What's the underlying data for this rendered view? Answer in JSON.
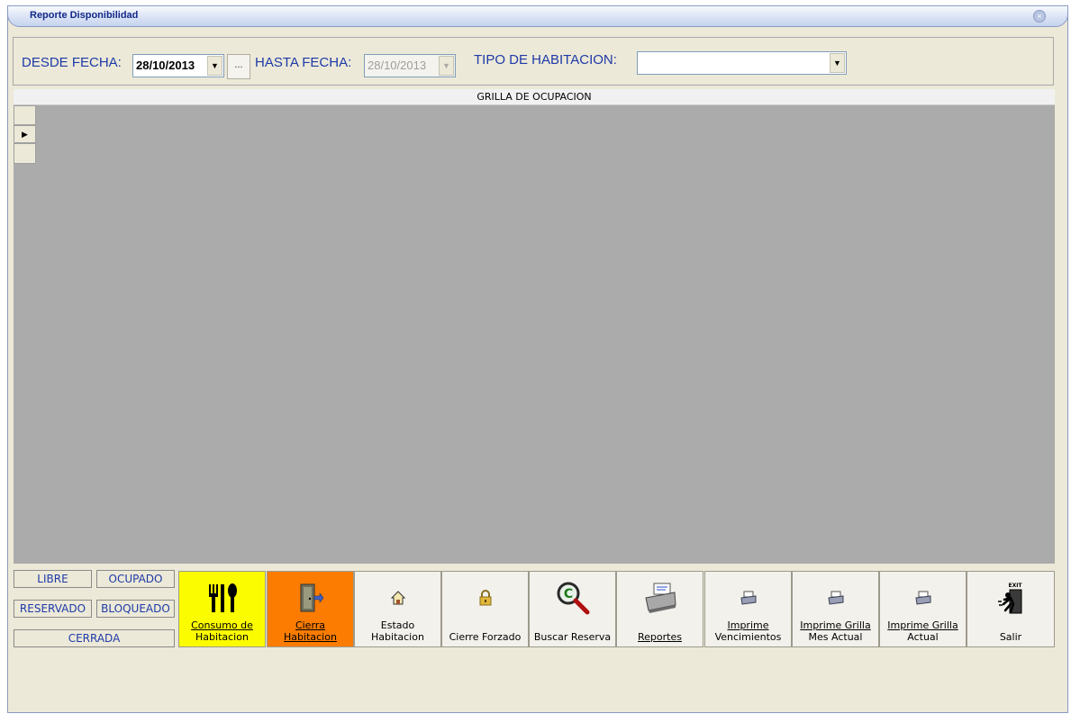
{
  "window": {
    "title": "Reporte Disponibilidad"
  },
  "filters": {
    "desde_label": "DESDE FECHA:",
    "desde_value": "28/10/2013",
    "dots_label": "...",
    "hasta_label": "HASTA FECHA:",
    "hasta_value": "28/10/2013",
    "tipo_label": "TIPO DE HABITACION:",
    "tipo_value": ""
  },
  "grid": {
    "caption": "GRILLA DE OCUPACION",
    "row_marker": "▶"
  },
  "legend": {
    "libre": "LIBRE",
    "ocupado": "OCUPADO",
    "reservado": "RESERVADO",
    "bloqueado": "BLOQUEADO",
    "cerrada": "CERRADA"
  },
  "toolbar": {
    "consumo_line1": "Consumo de",
    "consumo_line2": "Habitacion",
    "cierra": "Cierra Habitacion",
    "estado_line1": "Estado",
    "estado_line2": "Habitacion",
    "cierre_forzado": "Cierre Forzado",
    "buscar": "Buscar Reserva",
    "reportes": "Reportes",
    "imprime_venc_line1": "Imprime",
    "imprime_venc_line2": "Vencimientos",
    "imprime_mes_line1": "Imprime Grilla",
    "imprime_mes_line2": "Mes Actual",
    "imprime_actual_line1": "Imprime Grilla",
    "imprime_actual_line2": "Actual",
    "salir": "Salir",
    "exit_sign": "EXIT"
  },
  "colors": {
    "consumo_bg": "#fcfc00",
    "cierra_bg": "#fb7c00",
    "label_blue": "#1e3aa8",
    "grid_bg": "#ababab"
  },
  "icons": {
    "consumo": "fork-knife-icon",
    "cierra": "door-exit-icon",
    "estado": "house-icon",
    "cierre_forzado": "padlock-icon",
    "buscar": "magnifier-icon",
    "reportes": "printer-icon",
    "imprime": "printer-small-icon",
    "salir": "exit-runner-icon"
  }
}
